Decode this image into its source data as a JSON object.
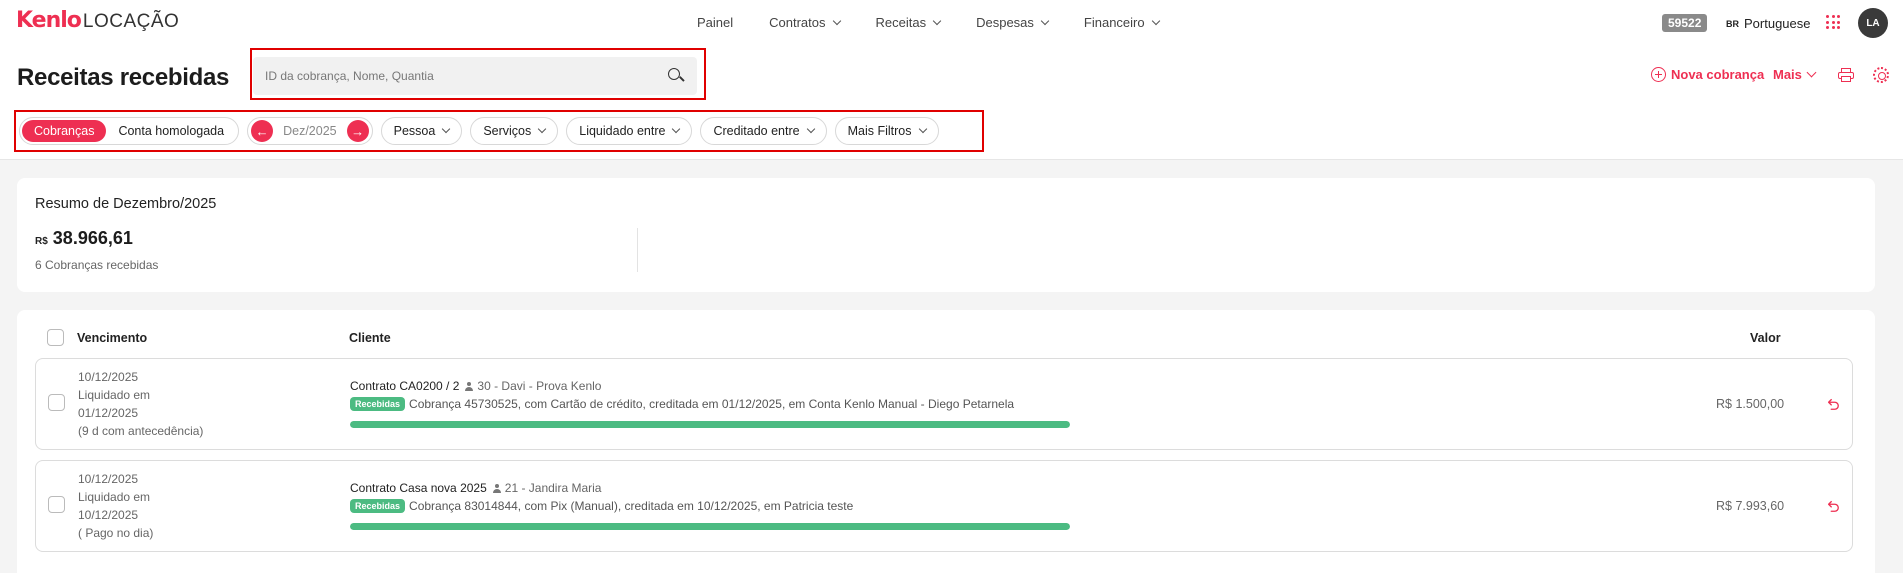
{
  "app": {
    "logo_brand": "Kenlo",
    "logo_sub": "LOCAÇÃO"
  },
  "nav": [
    {
      "label": "Painel",
      "dropdown": false
    },
    {
      "label": "Contratos",
      "dropdown": true
    },
    {
      "label": "Receitas",
      "dropdown": true
    },
    {
      "label": "Despesas",
      "dropdown": true
    },
    {
      "label": "Financeiro",
      "dropdown": true
    }
  ],
  "topbar": {
    "count_badge": "59522",
    "flag": "BR",
    "language": "Portuguese",
    "avatar_initials": "LA"
  },
  "page": {
    "title": "Receitas recebidas",
    "search_placeholder": "ID da cobrança, Nome, Quantia",
    "new_charge_label": "Nova cobrança",
    "more_label": "Mais"
  },
  "filters": {
    "segments": [
      {
        "label": "Cobranças",
        "active": true
      },
      {
        "label": "Conta homologada",
        "active": false
      }
    ],
    "period_label": "Dez/2025",
    "pills": [
      "Pessoa",
      "Serviços",
      "Liquidado entre",
      "Creditado entre",
      "Mais Filtros"
    ]
  },
  "summary": {
    "title": "Resumo de Dezembro/2025",
    "currency": "R$",
    "total": "38.966,61",
    "subtitle": "6 Cobranças recebidas"
  },
  "table": {
    "headers": {
      "due": "Vencimento",
      "client": "Cliente",
      "value": "Valor"
    },
    "rows": [
      {
        "due_date": "10/12/2025",
        "liquidated_label": "Liquidado em",
        "liquidated_date": "01/12/2025",
        "note": "(9 d com antecedência)",
        "contract": "Contrato CA0200 / 2",
        "person": "30 - Davi - Prova Kenlo",
        "tag": "Recebidas",
        "description": "Cobrança 45730525, com Cartão de crédito, creditada em 01/12/2025, em Conta Kenlo Manual - Diego Petarnela",
        "progress": 1.0,
        "value": "R$ 1.500,00"
      },
      {
        "due_date": "10/12/2025",
        "liquidated_label": "Liquidado em",
        "liquidated_date": "10/12/2025",
        "note": "( Pago no dia)",
        "contract": "Contrato Casa nova 2025",
        "person": "21 - Jandira Maria",
        "tag": "Recebidas",
        "description": "Cobrança 83014844, com Pix (Manual), creditada em 10/12/2025, em Patricia teste",
        "progress": 1.0,
        "value": "R$ 7.993,60"
      }
    ]
  },
  "colors": {
    "accent": "#ee2f52",
    "success": "#4cbb82"
  },
  "icons": [
    "search-icon",
    "plus-circle-icon",
    "chevron-down-icon",
    "print-icon",
    "gear-icon",
    "apps-grid-icon",
    "arrow-left-icon",
    "arrow-right-icon",
    "user-icon",
    "undo-icon"
  ]
}
